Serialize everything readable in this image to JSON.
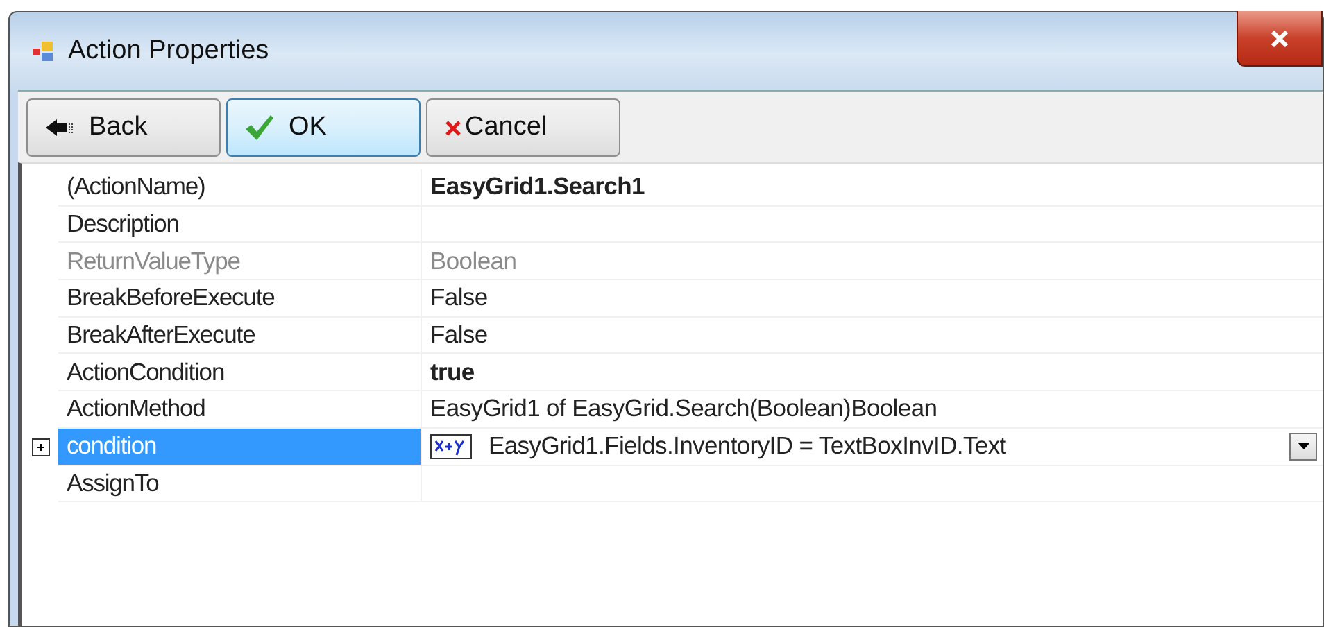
{
  "window": {
    "title": "Action Properties"
  },
  "toolbar": [
    {
      "kind": "back",
      "label": "Back",
      "selected": false
    },
    {
      "kind": "ok",
      "label": "OK",
      "selected": true
    },
    {
      "kind": "cancel",
      "label": "Cancel",
      "selected": false
    }
  ],
  "properties": [
    {
      "name": "(ActionName)",
      "value": "EasyGrid1.Search1",
      "bold": true,
      "disabled": false,
      "selected": false,
      "kind": "text"
    },
    {
      "name": "Description",
      "disabled": false,
      "selected": false,
      "kind": "text"
    },
    {
      "name": "ReturnValueType",
      "value": "Boolean",
      "bold": false,
      "disabled": true,
      "selected": false,
      "kind": "text"
    },
    {
      "name": "BreakBeforeExecute",
      "value": "False",
      "bold": false,
      "disabled": false,
      "selected": false,
      "kind": "text"
    },
    {
      "name": "BreakAfterExecute",
      "value": "False",
      "bold": false,
      "disabled": false,
      "selected": false,
      "kind": "text"
    },
    {
      "name": "ActionCondition",
      "value": "true",
      "bold": true,
      "disabled": false,
      "selected": false,
      "kind": "text"
    },
    {
      "name": "ActionMethod",
      "value": "EasyGrid1 of EasyGrid.Search(Boolean)Boolean",
      "bold": false,
      "disabled": false,
      "selected": false,
      "kind": "text"
    },
    {
      "name": "condition",
      "value": "EasyGrid1.Fields.InventoryID = TextBoxInvID.Text",
      "bold": false,
      "disabled": false,
      "selected": true,
      "kind": "expression",
      "expanded": false
    },
    {
      "name": "AssignTo",
      "disabled": false,
      "selected": false,
      "kind": "text"
    }
  ]
}
